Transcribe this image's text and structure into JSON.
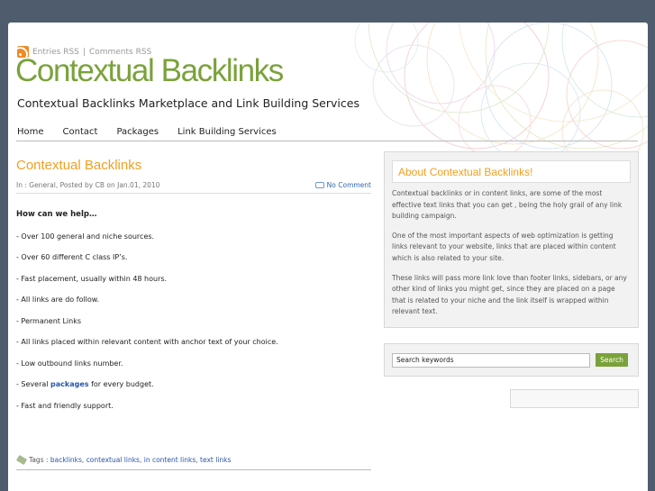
{
  "header": {
    "rss_entries": "Entries RSS",
    "rss_separator": "|",
    "rss_comments": "Comments RSS",
    "site_title": "Contextual Backlinks",
    "tagline": "Contextual Backlinks Marketplace and Link Building Services"
  },
  "nav": {
    "items": [
      {
        "label": "Home"
      },
      {
        "label": "Contact"
      },
      {
        "label": "Packages"
      },
      {
        "label": "Link Building Services"
      }
    ]
  },
  "post": {
    "title": "Contextual Backlinks",
    "meta": "In : General, Posted by CB on Jan.01, 2010",
    "comments": "No Comment",
    "heading": "How can we help…",
    "items": [
      "- Over 100 general and niche sources.",
      "- Over 60 different C class IP’s.",
      "- Fast placement, usually within 48 hours.",
      "- All links are do follow.",
      "- Permanent Links",
      "- All links placed within relevant content with anchor text of your choice.",
      "- Low outbound links number."
    ],
    "packages_prefix": "- Several",
    "packages_link": "packages",
    "packages_suffix": "for every budget.",
    "last_item": "- Fast and friendly support.",
    "tags_label": "Tags :",
    "tags": [
      "backlinks",
      "contextual links",
      "in content links",
      "text links"
    ]
  },
  "sidebar": {
    "about_title": "About Contextual Backlinks!",
    "about_paragraphs": [
      "Contextual backlinks or in content links, are some of the most effective text links that you can get , being the holy grail of any link building campaign.",
      "One of the most important aspects of web optimization is getting links relevant to your website, links that are placed within content which is also related to your site.",
      "These links will pass more link love than footer links, sidebars, or any other kind of links you might get, since they are placed on a page that is related to your niche and the link itself is wrapped within relevant text."
    ],
    "search_value": "Search keywords",
    "search_button": "Search"
  },
  "colors": {
    "brand_green": "#7aa23a",
    "title_orange": "#f0a020",
    "link_blue": "#2855a8",
    "page_bg": "#4e5c6e"
  },
  "icons": [
    "rss-icon",
    "comment-icon",
    "tag-icon"
  ]
}
